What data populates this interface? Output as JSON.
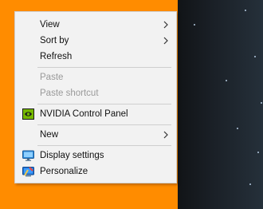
{
  "menu": {
    "items": [
      {
        "label": "View",
        "submenu": true
      },
      {
        "label": "Sort by",
        "submenu": true
      },
      {
        "label": "Refresh"
      },
      {
        "label": "Paste",
        "disabled": true
      },
      {
        "label": "Paste shortcut",
        "disabled": true
      },
      {
        "label": "NVIDIA Control Panel",
        "icon": "nvidia-icon"
      },
      {
        "label": "New",
        "submenu": true
      },
      {
        "label": "Display settings",
        "icon": "display-settings-icon"
      },
      {
        "label": "Personalize",
        "icon": "personalize-icon"
      }
    ]
  },
  "colors": {
    "desktop_background": "#ff8c00",
    "menu_background": "#f2f2f2",
    "disabled_text": "#9a9a9a",
    "nvidia_green": "#76b900"
  }
}
